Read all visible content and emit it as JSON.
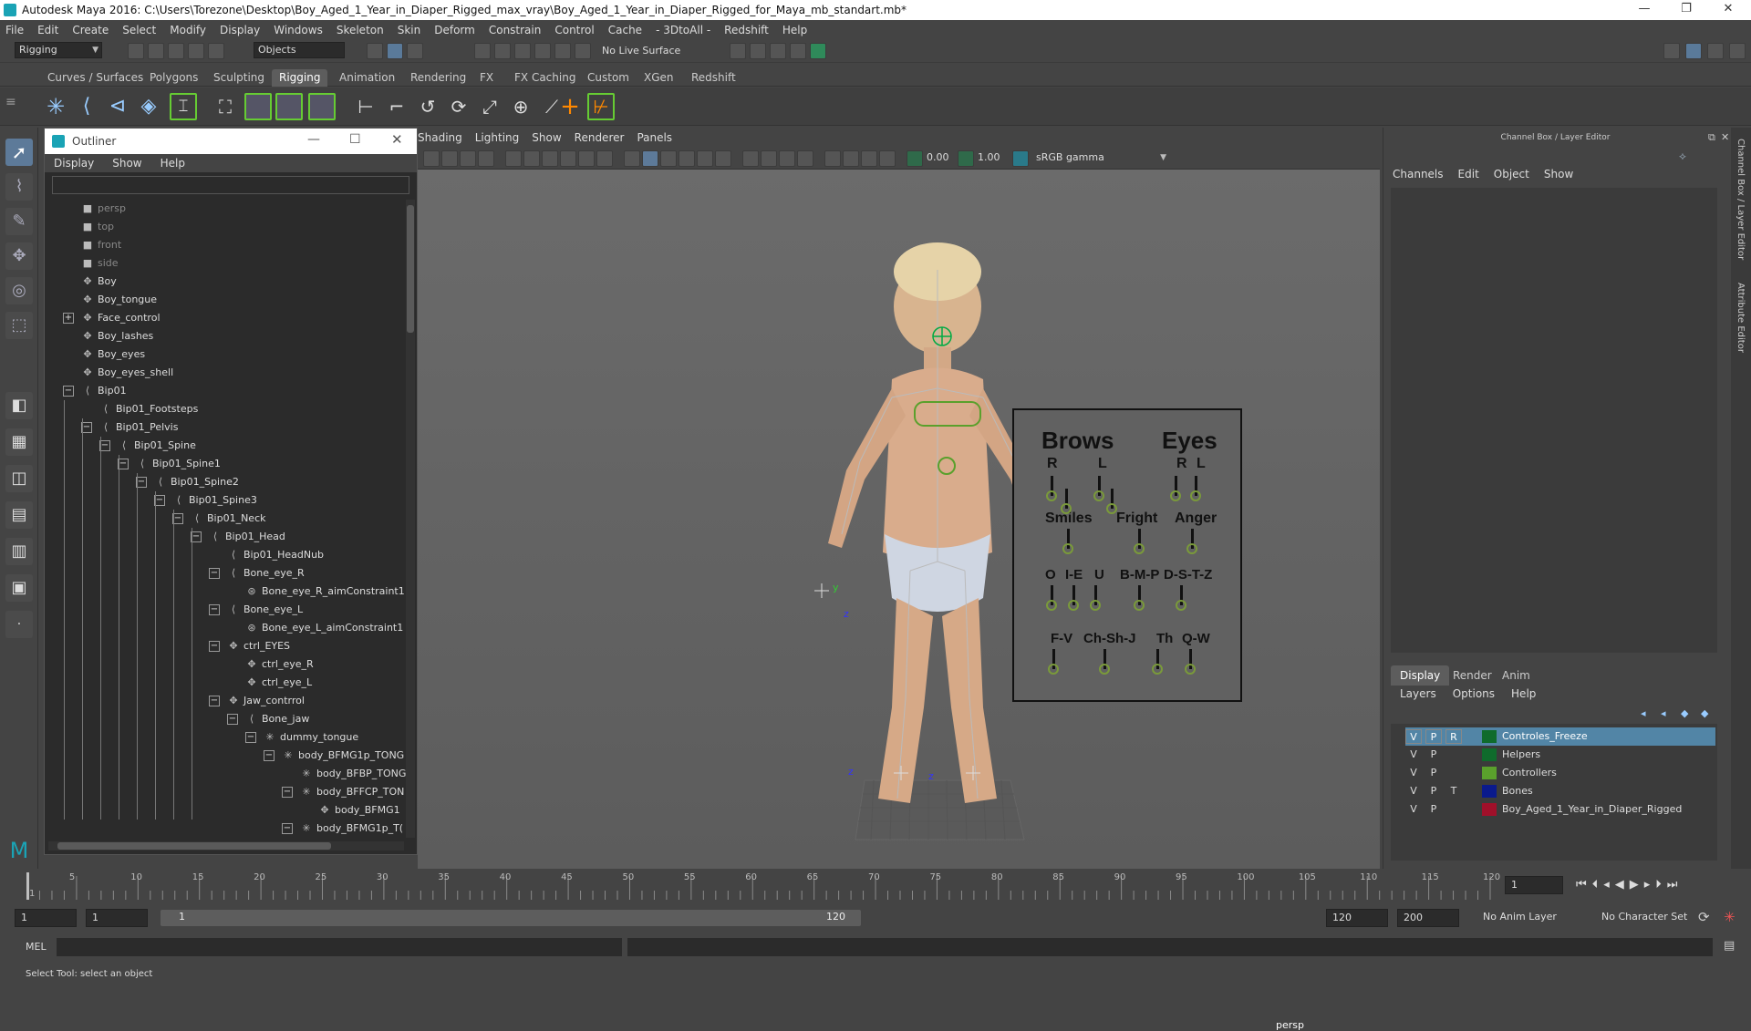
{
  "window": {
    "title": "Autodesk Maya 2016: C:\\Users\\Torezone\\Desktop\\Boy_Aged_1_Year_in_Diaper_Rigged_max_vray\\Boy_Aged_1_Year_in_Diaper_Rigged_for_Maya_mb_standart.mb*",
    "minimize": "—",
    "restore": "❐",
    "close": "✕"
  },
  "menubar": [
    "File",
    "Edit",
    "Create",
    "Select",
    "Modify",
    "Display",
    "Windows",
    "Skeleton",
    "Skin",
    "Deform",
    "Constrain",
    "Control",
    "Cache",
    "- 3DtoAll -",
    "Redshift",
    "Help"
  ],
  "statusline": {
    "mode": "Rigging",
    "selection": "Objects",
    "live_surface": "No Live Surface"
  },
  "shelf_tabs": [
    "Curves / Surfaces",
    "Polygons",
    "Sculpting",
    "Rigging",
    "Animation",
    "Rendering",
    "FX",
    "FX Caching",
    "Custom",
    "XGen",
    "Redshift"
  ],
  "active_shelf": "Rigging",
  "outliner": {
    "title": "Outliner",
    "menu": [
      "Display",
      "Show",
      "Help"
    ],
    "items": [
      {
        "label": "persp",
        "depth": 0,
        "icon": "camera-icon",
        "cam": true
      },
      {
        "label": "top",
        "depth": 0,
        "icon": "camera-icon",
        "cam": true
      },
      {
        "label": "front",
        "depth": 0,
        "icon": "camera-icon",
        "cam": true
      },
      {
        "label": "side",
        "depth": 0,
        "icon": "camera-icon",
        "cam": true
      },
      {
        "label": "Boy",
        "depth": 0,
        "icon": "mesh-icon"
      },
      {
        "label": "Boy_tongue",
        "depth": 0,
        "icon": "mesh-icon"
      },
      {
        "label": "Face_control",
        "depth": 0,
        "icon": "mesh-icon",
        "exp": "+"
      },
      {
        "label": "Boy_lashes",
        "depth": 0,
        "icon": "mesh-icon"
      },
      {
        "label": "Boy_eyes",
        "depth": 0,
        "icon": "mesh-icon"
      },
      {
        "label": "Boy_eyes_shell",
        "depth": 0,
        "icon": "mesh-icon"
      },
      {
        "label": "Bip01",
        "depth": 1,
        "icon": "joint-icon",
        "exp": "−"
      },
      {
        "label": "Bip01_Footsteps",
        "depth": 2,
        "icon": "joint-icon"
      },
      {
        "label": "Bip01_Pelvis",
        "depth": 2,
        "icon": "joint-icon",
        "exp": "−"
      },
      {
        "label": "Bip01_Spine",
        "depth": 3,
        "icon": "joint-icon",
        "exp": "−"
      },
      {
        "label": "Bip01_Spine1",
        "depth": 4,
        "icon": "joint-icon",
        "exp": "−"
      },
      {
        "label": "Bip01_Spine2",
        "depth": 5,
        "icon": "joint-icon",
        "exp": "−"
      },
      {
        "label": "Bip01_Spine3",
        "depth": 6,
        "icon": "joint-icon",
        "exp": "−"
      },
      {
        "label": "Bip01_Neck",
        "depth": 7,
        "icon": "joint-icon",
        "exp": "−"
      },
      {
        "label": "Bip01_Head",
        "depth": 8,
        "icon": "joint-icon",
        "exp": "−"
      },
      {
        "label": "Bip01_HeadNub",
        "depth": 9,
        "icon": "joint-icon"
      },
      {
        "label": "Bone_eye_R",
        "depth": 9,
        "icon": "joint-icon",
        "exp": "−"
      },
      {
        "label": "Bone_eye_R_aimConstraint1",
        "depth": 10,
        "icon": "constraint-icon"
      },
      {
        "label": "Bone_eye_L",
        "depth": 9,
        "icon": "joint-icon",
        "exp": "−"
      },
      {
        "label": "Bone_eye_L_aimConstraint1",
        "depth": 10,
        "icon": "constraint-icon"
      },
      {
        "label": "ctrl_EYES",
        "depth": 9,
        "icon": "curve-icon",
        "exp": "−"
      },
      {
        "label": "ctrl_eye_R",
        "depth": 10,
        "icon": "curve-icon"
      },
      {
        "label": "ctrl_eye_L",
        "depth": 10,
        "icon": "curve-icon"
      },
      {
        "label": "Jaw_contrrol",
        "depth": 9,
        "icon": "curve-icon",
        "exp": "−"
      },
      {
        "label": "Bone_jaw",
        "depth": 10,
        "icon": "joint-icon",
        "exp": "−"
      },
      {
        "label": "dummy_tongue",
        "depth": 11,
        "icon": "locator-icon",
        "exp": "−"
      },
      {
        "label": "body_BFMG1p_TONG",
        "depth": 12,
        "icon": "locator-icon",
        "exp": "−"
      },
      {
        "label": "body_BFBP_TONG",
        "depth": 13,
        "icon": "locator-icon"
      },
      {
        "label": "body_BFFCP_TON",
        "depth": 13,
        "icon": "locator-icon",
        "exp": "−"
      },
      {
        "label": "body_BFMG1",
        "depth": 14,
        "icon": "mesh-icon"
      },
      {
        "label": "body_BFMG1p_T(",
        "depth": 13,
        "icon": "locator-icon",
        "exp": "−"
      }
    ]
  },
  "panel_menu": [
    "Shading",
    "Lighting",
    "Show",
    "Renderer",
    "Panels"
  ],
  "view_toolbar": {
    "gamma_a": "0.00",
    "gamma_b": "1.00",
    "colorspace": "sRGB gamma"
  },
  "viewport": {
    "camera": "persp"
  },
  "face_panel": {
    "labels": [
      "Brows",
      "Eyes",
      "R",
      "L",
      "R",
      "L",
      "Smiles",
      "Fright",
      "Anger",
      "O",
      "I-E",
      "U",
      "B-M-P",
      "D-S-T-Z",
      "F-V",
      "Ch-Sh-J",
      "Th",
      "Q-W"
    ]
  },
  "channel_box": {
    "title": "Channel Box / Layer Editor",
    "menu": [
      "Channels",
      "Edit",
      "Object",
      "Show"
    ],
    "layer_tabs": [
      "Display",
      "Render",
      "Anim"
    ],
    "layer_menu": [
      "Layers",
      "Options",
      "Help"
    ],
    "layers": [
      {
        "v": "V",
        "p": "P",
        "t": "R",
        "color": "#0f6b2c",
        "name": "Controles_Freeze",
        "selected": true
      },
      {
        "v": "V",
        "p": "P",
        "t": "",
        "color": "#0f6b2c",
        "name": "Helpers"
      },
      {
        "v": "V",
        "p": "P",
        "t": "",
        "color": "#5aa02c",
        "name": "Controllers"
      },
      {
        "v": "V",
        "p": "P",
        "t": "T",
        "color": "#0a1a8c",
        "name": "Bones"
      },
      {
        "v": "V",
        "p": "P",
        "t": "",
        "color": "#a0102a",
        "name": "Boy_Aged_1_Year_in_Diaper_Rigged"
      }
    ],
    "side_tabs": [
      "Channel Box / Layer Editor",
      "Attribute Editor"
    ]
  },
  "timeline": {
    "ticks": [
      "1",
      "5",
      "10",
      "15",
      "20",
      "25",
      "30",
      "35",
      "40",
      "45",
      "50",
      "55",
      "60",
      "65",
      "70",
      "75",
      "80",
      "85",
      "90",
      "95",
      "100",
      "105",
      "110",
      "115",
      "120"
    ],
    "current_frame": "1"
  },
  "range": {
    "start": "1",
    "start2": "1",
    "slider_start": "1",
    "slider_end": "120",
    "end": "120",
    "end2": "200",
    "anim_layer": "No Anim Layer",
    "char_set": "No Character Set"
  },
  "cmdline": {
    "label": "MEL"
  },
  "helpline": "Select Tool: select an object"
}
